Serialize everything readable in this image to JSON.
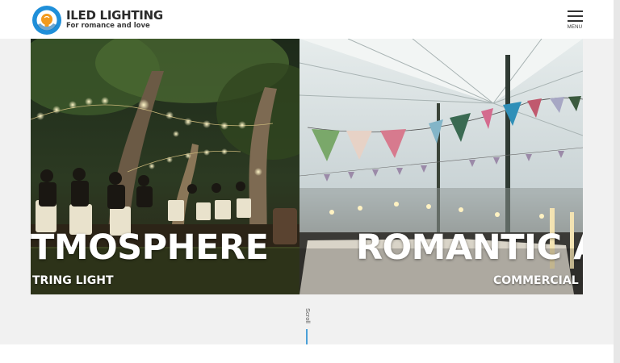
{
  "header": {
    "brand_name": "ILED LIGHTING",
    "tagline": "For romance and love",
    "menu_label": "MENU"
  },
  "slider": {
    "slides": [
      {
        "title": "TMOSPHERE",
        "subtitle": "TRING LIGHT"
      },
      {
        "title": "ROMANTIC A",
        "subtitle": "COMMERCIAL S"
      }
    ]
  },
  "scroll_hint": {
    "label": "Scroll"
  },
  "colors": {
    "logo_blue": "#1f8fd9",
    "logo_orange": "#f29a1e",
    "scroll_line": "#4aa0d8",
    "background": "#f1f1f1"
  }
}
